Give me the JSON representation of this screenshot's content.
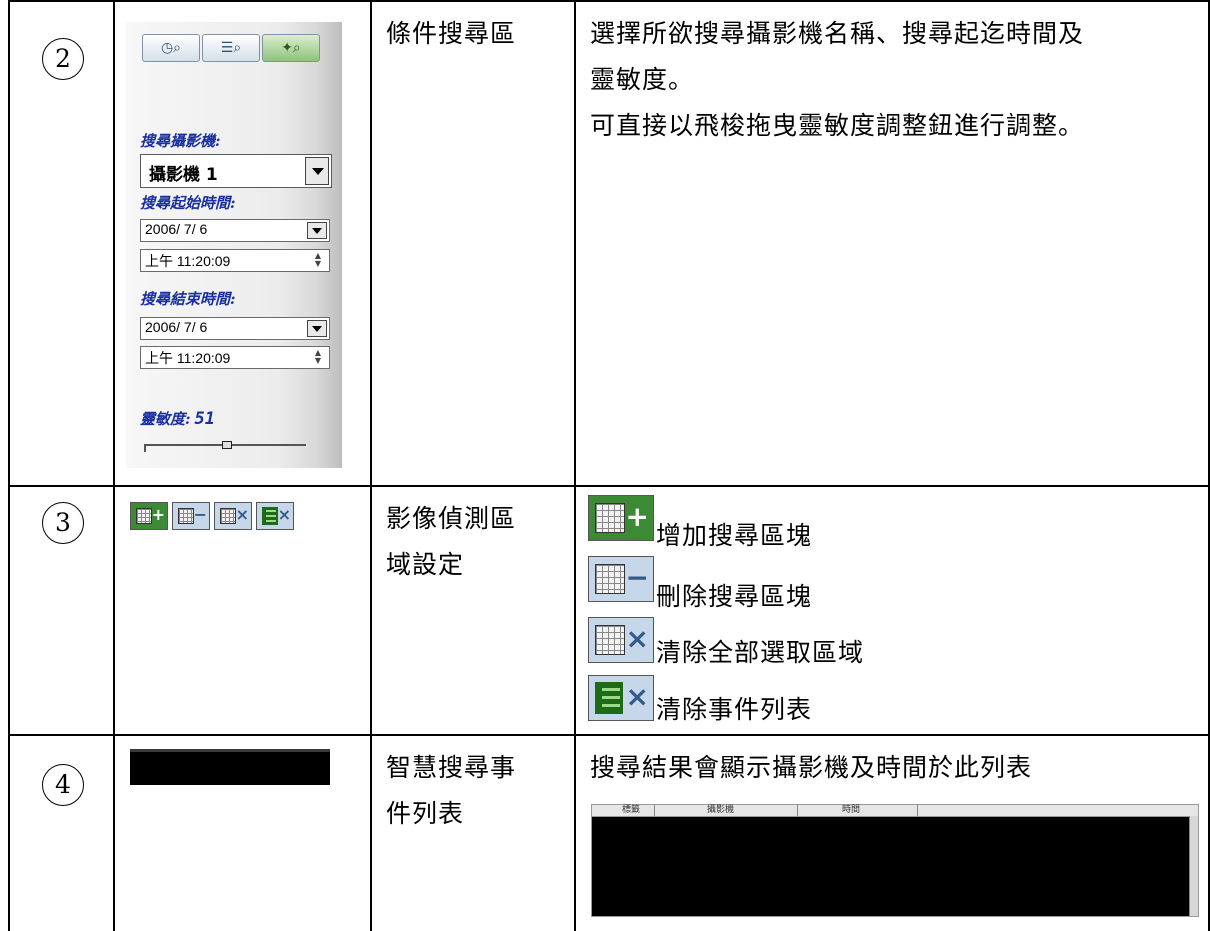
{
  "rows": [
    {
      "number": "2",
      "name": "條件搜尋區",
      "description": [
        "選擇所欲搜尋攝影機名稱、搜尋起迄時間及",
        "靈敏度。",
        "可直接以飛梭拖曳靈敏度調整鈕進行調整。"
      ]
    },
    {
      "number": "3",
      "name_lines": [
        "影像偵測區",
        "域設定"
      ],
      "actions": [
        {
          "icon": "add-block-icon",
          "label": "增加搜尋區塊"
        },
        {
          "icon": "delete-block-icon",
          "label": "刪除搜尋區塊"
        },
        {
          "icon": "clear-selection-icon",
          "label": "清除全部選取區域"
        },
        {
          "icon": "clear-list-icon",
          "label": "清除事件列表"
        }
      ]
    },
    {
      "number": "4",
      "name_lines": [
        "智慧搜尋事",
        "件列表"
      ],
      "description": "搜尋結果會顯示攝影機及時間於此列表"
    }
  ],
  "search_panel": {
    "camera_label": "搜尋攝影機:",
    "camera_value": "攝影機 1",
    "start_label": "搜尋起始時間:",
    "start_date": "2006/ 7/ 6",
    "start_time": "上午 11:20:09",
    "end_label": "搜尋結束時間:",
    "end_date": "2006/ 7/ 6",
    "end_time": "上午 11:20:09",
    "sensitivity_label": "靈敏度:",
    "sensitivity_value": "51",
    "sensitivity_fraction": 0.51,
    "top_buttons": [
      {
        "icon": "clock-search-icon",
        "selected": false
      },
      {
        "icon": "list-search-icon",
        "selected": false
      },
      {
        "icon": "motion-search-icon",
        "selected": true
      }
    ]
  },
  "event_list": {
    "columns": [
      "標籤",
      "攝影機",
      "時間"
    ]
  },
  "colors": {
    "label_blue": "#1a2fa0",
    "tool_green": "#3c8a35",
    "tool_blue": "#c7d7ea"
  }
}
